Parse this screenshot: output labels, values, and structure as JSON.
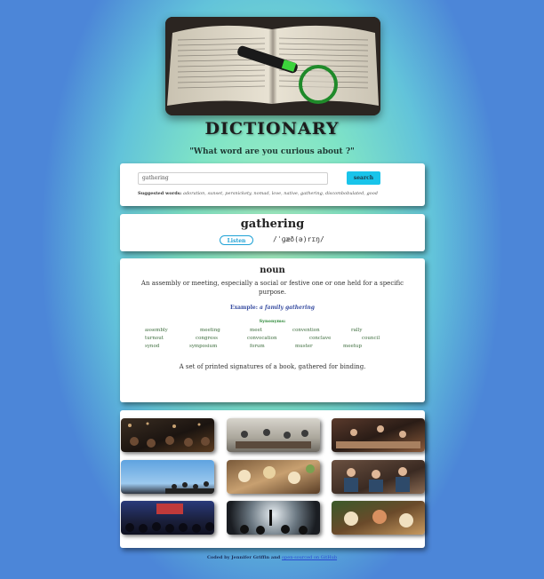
{
  "header": {
    "title": "DICTIONARY",
    "subtitle": "\"What word are you curious about ?\""
  },
  "search": {
    "value": "gathering",
    "button_label": "search",
    "suggested_label": "Suggested words:",
    "suggested_words": "adoration, sunset, persnickety, nomad, love, native, gathering, discombobulated, good"
  },
  "word": {
    "text": "gathering",
    "listen_label": "Listen",
    "phonetic": "/ˈɡæð(ə)rɪŋ/"
  },
  "meaning": {
    "part_of_speech": "noun",
    "definition": "An assembly or meeting, especially a social or festive one or one held for a specific purpose.",
    "example_label": "Example:",
    "example": "a family gathering",
    "synonyms_label": "Synonyms:",
    "synonyms": [
      "assembly",
      "meeting",
      "meet",
      "convention",
      "rally",
      "turnout",
      "congress",
      "convocation",
      "conclave",
      "council",
      "synod",
      "symposium",
      "forum",
      "muster",
      "meetup"
    ],
    "definition2": "A set of printed signatures of a book, gathered for binding."
  },
  "gallery": {
    "images": [
      "crowd-image",
      "meeting-image",
      "dinner-image",
      "sky-crowd-image",
      "food-table-image",
      "friends-image",
      "audience-image",
      "concert-image",
      "feast-image"
    ]
  },
  "footer": {
    "credit": "Coded by Jennifer Griffin and ",
    "link_text": "open-sourced on GitHub"
  },
  "colors": {
    "accent": "#19c4ea",
    "synonym": "#3d6d3d",
    "example": "#3a4fa2"
  }
}
